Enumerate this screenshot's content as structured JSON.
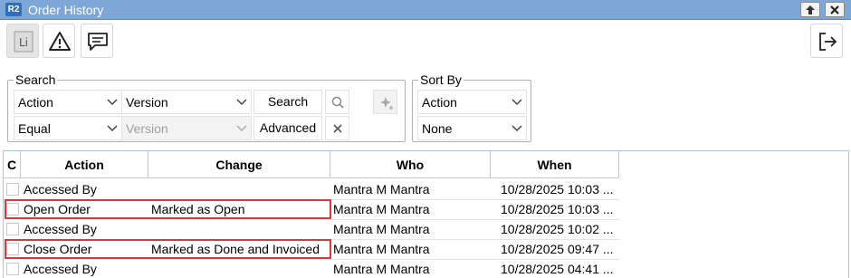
{
  "window": {
    "badge": "R2",
    "title": "Order History"
  },
  "toolbar": {
    "list_glyph": "Li",
    "icons": [
      "list-icon",
      "warning-icon",
      "comment-icon",
      "logout-icon"
    ]
  },
  "search": {
    "legend": "Search",
    "field1": "Action",
    "version1": "Version",
    "search_button": "Search",
    "operator": "Equal",
    "version2": "Version",
    "advanced_button": "Advanced"
  },
  "sort": {
    "legend": "Sort By",
    "field": "Action",
    "order": "None"
  },
  "grid": {
    "columns": [
      "C",
      "Action",
      "Change",
      "Who",
      "When"
    ],
    "rows": [
      {
        "action": "Accessed By",
        "change": "",
        "who": "Mantra M Mantra",
        "when": "10/28/2025 10:03 ...",
        "highlighted": false
      },
      {
        "action": "Open Order",
        "change": "Marked as Open",
        "who": "Mantra M Mantra",
        "when": "10/28/2025 10:03 ...",
        "highlighted": true
      },
      {
        "action": "Accessed By",
        "change": "",
        "who": "Mantra M Mantra",
        "when": "10/28/2025 10:02 ...",
        "highlighted": false
      },
      {
        "action": "Close Order",
        "change": "Marked as Done and Invoiced",
        "who": "Mantra M Mantra",
        "when": "10/28/2025 09:47 ...",
        "highlighted": true
      },
      {
        "action": "Accessed By",
        "change": "",
        "who": "Mantra M Mantra",
        "when": "10/28/2025 04:41 ...",
        "highlighted": false
      }
    ]
  },
  "colors": {
    "titlebar": "#7da7d6",
    "highlight": "#d9393b"
  }
}
